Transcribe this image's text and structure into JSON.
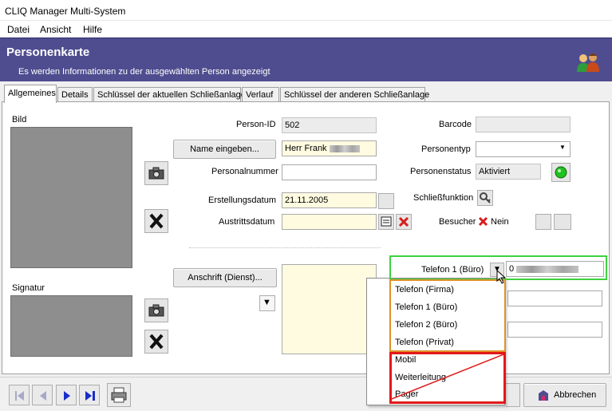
{
  "window": {
    "title": "CLIQ Manager Multi-System"
  },
  "menu": {
    "file": "Datei",
    "view": "Ansicht",
    "help": "Hilfe"
  },
  "header": {
    "title": "Personenkarte",
    "subtitle": "Es werden Informationen zu der ausgewählten Person angezeigt"
  },
  "tabs": [
    "Allgemeines",
    "Details",
    "Schlüssel der aktuellen Schließanlage",
    "Verlauf",
    "Schlüssel der anderen Schließanlage"
  ],
  "left": {
    "image_label": "Bild",
    "signature_label": "Signatur"
  },
  "form": {
    "person_id_label": "Person-ID",
    "person_id_value": "502",
    "name_button": "Name eingeben...",
    "name_value": "Herr Frank",
    "personnel_number_label": "Personalnummer",
    "personnel_number_value": "",
    "created_label": "Erstellungsdatum",
    "created_value": "21.11.2005",
    "exit_label": "Austrittsdatum",
    "exit_value": "",
    "barcode_label": "Barcode",
    "barcode_value": "",
    "person_type_label": "Personentyp",
    "person_type_value": "",
    "status_label": "Personenstatus",
    "status_value": "Aktiviert",
    "locking_function_label": "Schließfunktion",
    "visitor_label": "Besucher",
    "visitor_value": "Nein",
    "address_button": "Anschrift (Dienst)...",
    "phone_label": "Telefon 1 (Büro)",
    "phone_value": "0"
  },
  "phone_dropdown": {
    "options": [
      "Telefon (Firma)",
      "Telefon 1 (Büro)",
      "Telefon 2 (Büro)",
      "Telefon (Privat)",
      "Mobil",
      "Weiterleitung",
      "Pager"
    ]
  },
  "footer": {
    "cancel_label": "Abbrechen"
  },
  "colors": {
    "header_bg": "#4f4d8f",
    "status_green": "#1fc21f",
    "highlight_green": "#3fd13f",
    "highlight_orange": "#e0902a",
    "highlight_red": "#e21818"
  }
}
